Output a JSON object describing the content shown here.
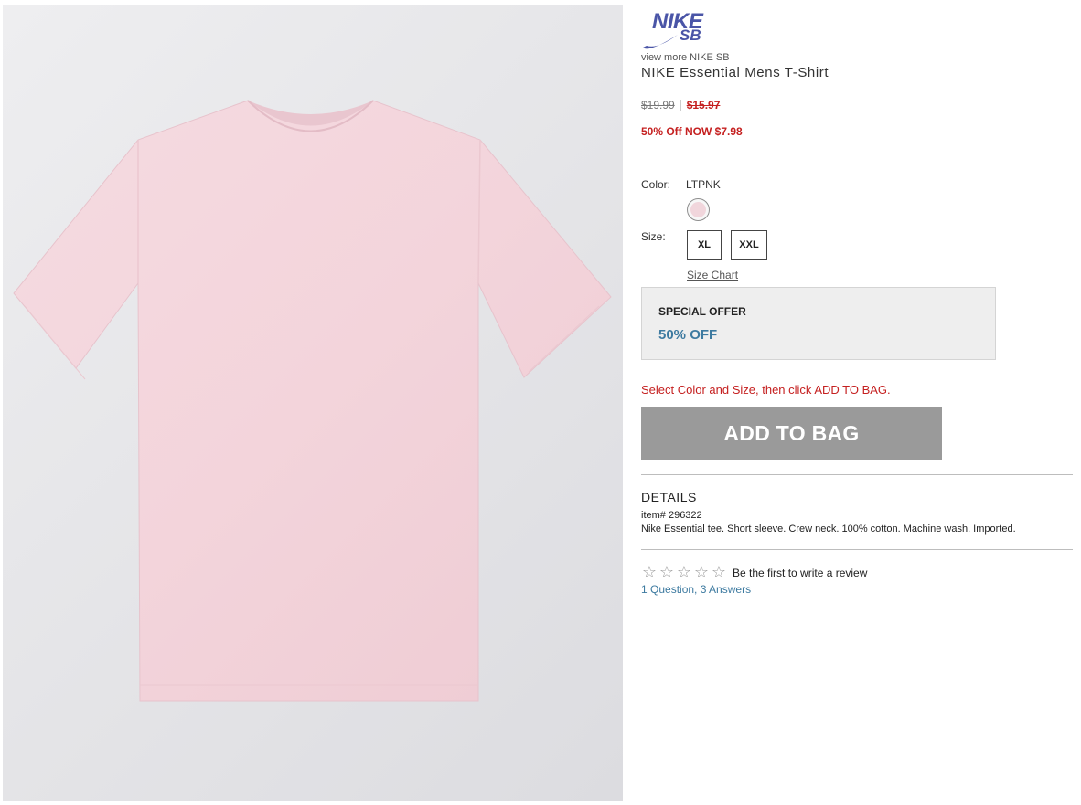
{
  "product": {
    "brand_logo": {
      "text_main": "NIKE",
      "text_sub": "SB",
      "icon": "swoosh-icon",
      "color": "#4a55a7"
    },
    "view_more": "view more NIKE SB",
    "title": "NIKE Essential Mens T-Shirt",
    "image_icon": "pink-tshirt-image",
    "shirt_color": "#f3d5dc"
  },
  "pricing": {
    "original": "$19.99",
    "sale": "$15.97",
    "promo": "50% Off NOW $7.98",
    "sale_color": "#c52020"
  },
  "options": {
    "color_label": "Color:",
    "color_value": "LTPNK",
    "swatch_color": "#f1d6dc",
    "size_label": "Size:",
    "sizes": [
      "XL",
      "XXL"
    ],
    "size_chart": "Size Chart"
  },
  "offer": {
    "title": "SPECIAL OFFER",
    "value": "50% OFF",
    "value_color": "#3d7aa0"
  },
  "cart": {
    "instruction": "Select Color and Size, then click ADD TO BAG.",
    "button": "ADD TO BAG",
    "button_color": "#9a9a9a"
  },
  "details": {
    "heading": "DETAILS",
    "item_number": "item# 296322",
    "description": "Nike Essential tee. Short sleeve. Crew neck. 100% cotton. Machine wash. Imported."
  },
  "reviews": {
    "rating": 0,
    "max_rating": 5,
    "star_glyph": "☆",
    "prompt": "Be the first to write a review",
    "qa": "1 Question, 3 Answers"
  }
}
